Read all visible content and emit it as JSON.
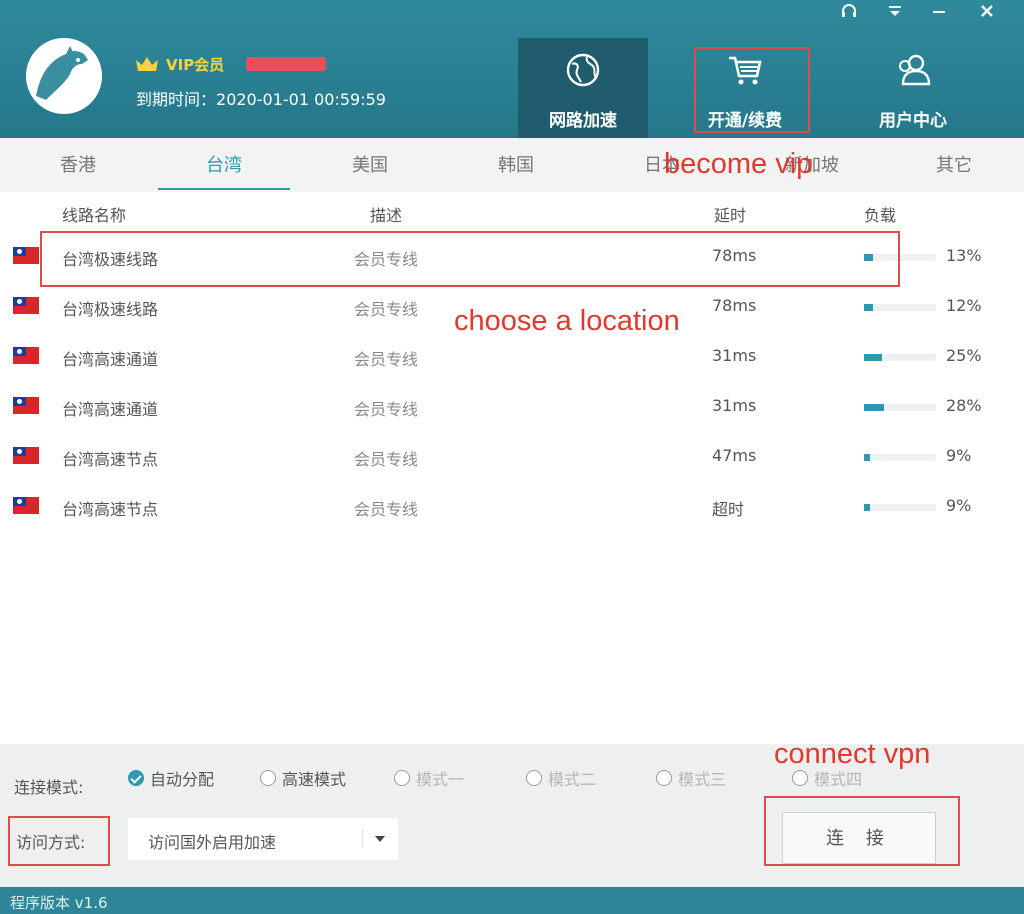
{
  "window": {
    "controls": [
      "headset-icon",
      "dropdown-icon",
      "minimize-icon",
      "close-icon"
    ],
    "control_glyphs": [
      "☊",
      "▾",
      "–",
      "✕"
    ]
  },
  "user": {
    "vip_label": "VIP会员",
    "expire_label": "到期时间：",
    "expire_value": "2020-01-01 00:59:59"
  },
  "nav": [
    {
      "label": "网路加速",
      "icon": "globe-icon",
      "active": true
    },
    {
      "label": "开通/续费",
      "icon": "cart-icon",
      "active": false
    },
    {
      "label": "用户中心",
      "icon": "users-icon",
      "active": false
    }
  ],
  "tabs": [
    "香港",
    "台湾",
    "美国",
    "韩国",
    "日本",
    "新加坡",
    "其它"
  ],
  "active_tab": "台湾",
  "table": {
    "headers": [
      "线路名称",
      "描述",
      "延时",
      "负载"
    ],
    "rows": [
      {
        "name": "台湾极速线路",
        "desc": "会员专线",
        "latency": "78ms",
        "load": "13%",
        "load_value": 13
      },
      {
        "name": "台湾极速线路",
        "desc": "会员专线",
        "latency": "78ms",
        "load": "12%",
        "load_value": 12
      },
      {
        "name": "台湾高速通道",
        "desc": "会员专线",
        "latency": "31ms",
        "load": "25%",
        "load_value": 25
      },
      {
        "name": "台湾高速通道",
        "desc": "会员专线",
        "latency": "31ms",
        "load": "28%",
        "load_value": 28
      },
      {
        "name": "台湾高速节点",
        "desc": "会员专线",
        "latency": "47ms",
        "load": "9%",
        "load_value": 9
      },
      {
        "name": "台湾高速节点",
        "desc": "会员专线",
        "latency": "超时",
        "load": "9%",
        "load_value": 9
      }
    ]
  },
  "connect_mode": {
    "label": "连接模式:",
    "options": [
      {
        "label": "自动分配",
        "checked": true,
        "enabled": true
      },
      {
        "label": "高速模式",
        "checked": false,
        "enabled": true
      },
      {
        "label": "模式一",
        "checked": false,
        "enabled": false
      },
      {
        "label": "模式二",
        "checked": false,
        "enabled": false
      },
      {
        "label": "模式三",
        "checked": false,
        "enabled": false
      },
      {
        "label": "模式四",
        "checked": false,
        "enabled": false
      }
    ]
  },
  "access": {
    "label": "访问方式:",
    "selected": "访问国外启用加速"
  },
  "connect_button": "连 接",
  "version": "程序版本 v1.6",
  "annotations": {
    "become_vip": "become vip",
    "choose_location": "choose a location",
    "connect_vpn": "connect vpn"
  },
  "colors": {
    "header": "#2a8395",
    "accent": "#2e97b2",
    "annotation": "#e0392f",
    "vip_gold": "#ffd23a"
  }
}
